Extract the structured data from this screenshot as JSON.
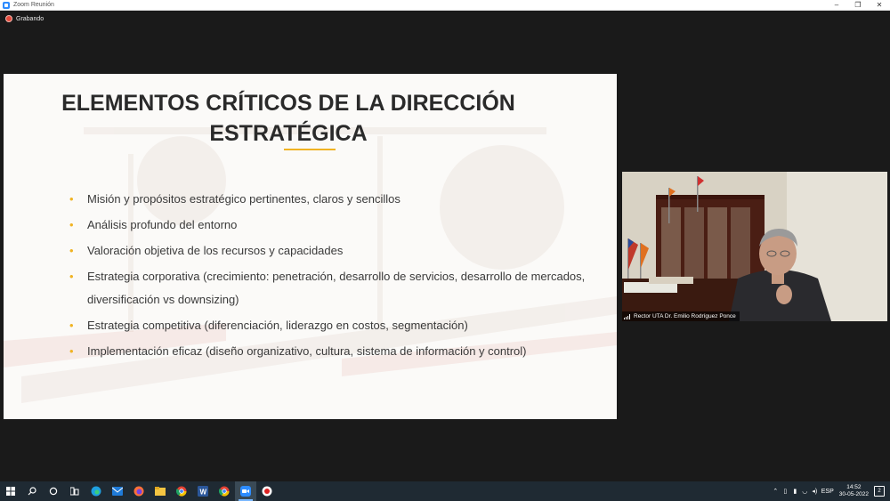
{
  "window": {
    "title": "Zoom Reunión",
    "controls": {
      "minimize": "–",
      "maximize": "❐",
      "close": "✕"
    }
  },
  "recording": {
    "label": "Grabando",
    "color": "#e64a3c"
  },
  "slide": {
    "title_line1": "ELEMENTOS CRÍTICOS DE LA DIRECCIÓN",
    "title_line2": "ESTRATÉGICA",
    "accent_color": "#f0b323",
    "bullets": [
      "Misión y propósitos estratégico pertinentes, claros y sencillos",
      "Análisis profundo del entorno",
      "Valoración objetiva de los recursos y capacidades",
      "Estrategia corporativa (crecimiento: penetración, desarrollo de servicios, desarrollo de mercados, diversificación  vs downsizing)",
      "Estrategia competitiva (diferenciación, liderazgo en costos, segmentación)",
      "Implementación eficaz (diseño organizativo, cultura, sistema de información y control)"
    ],
    "bullet_glyph": "•"
  },
  "video": {
    "participant_name": "Rector UTA Dr. Emilio Rodríguez Ponce"
  },
  "taskbar": {
    "apps": [
      "start-icon",
      "search-icon",
      "cortana-icon",
      "task-view-icon",
      "edge-icon",
      "mail-icon",
      "firefox-icon",
      "file-explorer-icon",
      "chrome-icon",
      "word-icon",
      "chrome-profile-icon",
      "zoom-icon",
      "screen-recorder-icon"
    ],
    "language": "ESP",
    "time": "14:52",
    "date": "30-05-2022",
    "notification_count": "2"
  }
}
